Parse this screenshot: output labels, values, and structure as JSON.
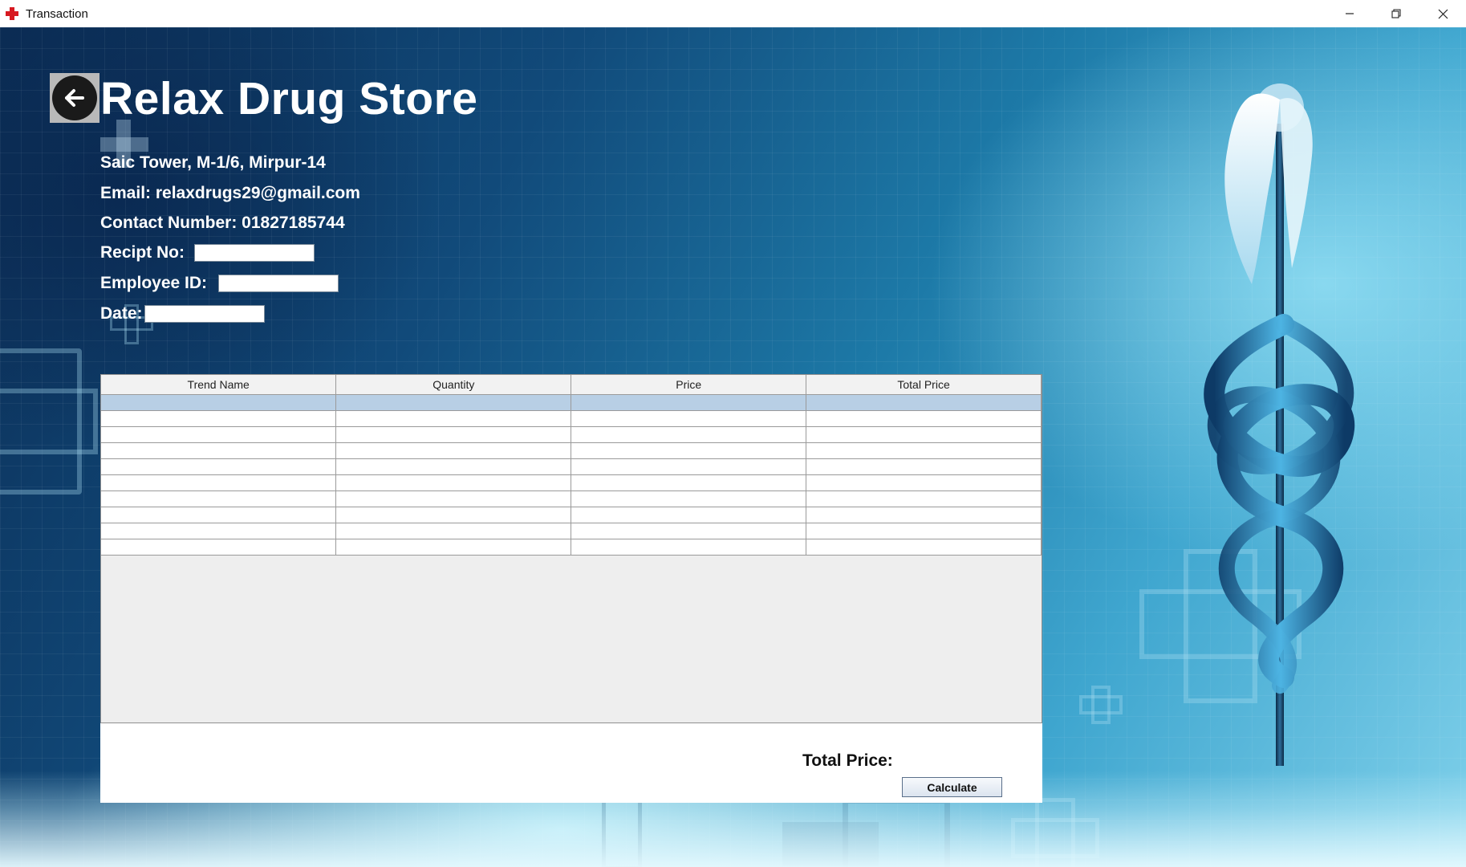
{
  "window": {
    "title": "Transaction"
  },
  "store": {
    "name": "Relax Drug Store",
    "address": "Saic Tower, M-1/6, Mirpur-14",
    "email": "Email: relaxdrugs29@gmail.com",
    "contact": "Contact Number: 01827185744"
  },
  "form": {
    "receipt_label": "Recipt No:",
    "receipt_value": "",
    "employee_label": "Employee ID:",
    "employee_value": "",
    "date_label": "Date:",
    "date_value": ""
  },
  "table": {
    "columns": [
      "Trend Name",
      "Quantity",
      "Price",
      "Total Price"
    ],
    "row_count": 10,
    "selected_row": 0
  },
  "footer": {
    "total_label": "Total Price:",
    "calculate_label": "Calculate"
  },
  "colors": {
    "title_text": "#ffffff",
    "selected_row": "#b8cfe5",
    "brand_icon": "#d71920"
  },
  "icons": [
    "app-cross-icon",
    "back-arrow-icon",
    "minimize-icon",
    "restore-icon",
    "close-icon",
    "caduceus-image"
  ]
}
